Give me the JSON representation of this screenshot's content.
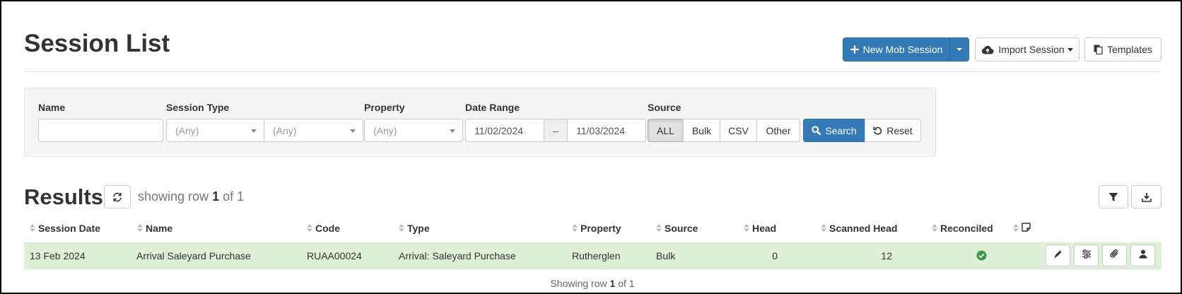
{
  "header": {
    "title": "Session List",
    "new_session_label": "New Mob Session",
    "import_label": "Import Session",
    "templates_label": "Templates"
  },
  "filters": {
    "name_label": "Name",
    "name_value": "",
    "session_type_label": "Session Type",
    "session_type_value": "(Any)",
    "session_subtype_value": "(Any)",
    "property_label": "Property",
    "property_value": "(Any)",
    "date_range_label": "Date Range",
    "date_from": "11/02/2024",
    "date_sep": "–",
    "date_to": "11/03/2024",
    "source_label": "Source",
    "source_options": [
      "ALL",
      "Bulk",
      "CSV",
      "Other"
    ],
    "source_selected": "ALL",
    "search_label": "Search",
    "reset_label": "Reset"
  },
  "results": {
    "title": "Results",
    "showing_prefix": "showing row",
    "showing_current": "1",
    "showing_of": "of 1",
    "columns": [
      "Session Date",
      "Name",
      "Code",
      "Type",
      "Property",
      "Source",
      "Head",
      "Scanned Head",
      "Reconciled"
    ],
    "rows": [
      {
        "session_date": "13 Feb 2024",
        "name": "Arrival Saleyard Purchase",
        "code": "RUAA00024",
        "type": "Arrival: Saleyard Purchase",
        "property": "Rutherglen",
        "source": "Bulk",
        "head": "0",
        "scanned_head": "12",
        "reconciled": "check-circle-icon"
      }
    ],
    "footer_prefix": "Showing row",
    "footer_current": "1",
    "footer_of": "of 1"
  },
  "colors": {
    "primary": "#337ab7",
    "row_success": "#dff0d8",
    "check_green": "#3c9a46"
  }
}
